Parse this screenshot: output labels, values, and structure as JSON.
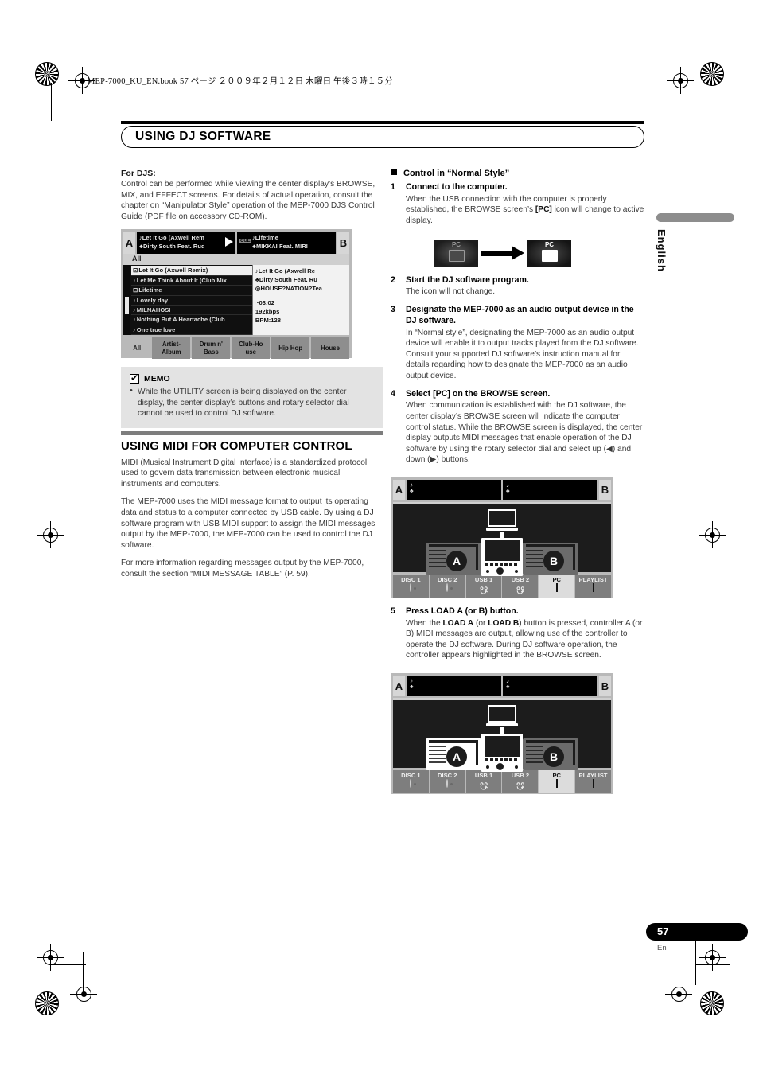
{
  "header": {
    "running_head": "MEP-7000_KU_EN.book   57 ページ   ２００９年２月１２日   木曜日   午後３時１５分",
    "section_title": "USING DJ SOFTWARE"
  },
  "side": {
    "language": "English"
  },
  "footer": {
    "page_number": "57",
    "page_suffix": "En"
  },
  "left": {
    "for_djs": {
      "heading": "For DJS:",
      "body": "Control can be performed while viewing the center display’s BROWSE, MIX, and EFFECT screens. For details of actual operation, consult the chapter on “Manipulator Style” operation of the MEP-7000 DJS Control Guide (PDF file on accessory CD-ROM)."
    },
    "browse_screen": {
      "deck_a_label": "A",
      "deck_b_label": "B",
      "deck_a_title": "Let It Go (Axwell Rem",
      "deck_a_artist": "Dirty South Feat. Rud",
      "deck_b_cue": "CUE",
      "deck_b_title": "Lifetime",
      "deck_b_artist": "MIKKAI Feat. MIRI",
      "folder_label": "All",
      "tracks": [
        {
          "title": "Let It Go (Axwell Remix)",
          "selected": true
        },
        {
          "title": "Let Me Think About It (Club Mix",
          "selected": false
        },
        {
          "title": "Lifetime",
          "selected": false
        },
        {
          "title": "Lovely day",
          "selected": false
        },
        {
          "title": "MILNAHOSI",
          "selected": false
        },
        {
          "title": "Nothing But A Heartache (Club",
          "selected": false
        },
        {
          "title": "One true love",
          "selected": false
        }
      ],
      "info": {
        "title": "Let It Go (Axwell Re",
        "artist": "Dirty South Feat. Ru",
        "album": "HOUSE?NATION?Tea",
        "time": "03:02",
        "bitrate": "192kbps",
        "bpm": "BPM:128"
      },
      "tabs": [
        "All",
        "Artist-Album",
        "Drum n' Bass",
        "Club-House",
        "Hip Hop",
        "House"
      ]
    },
    "memo": {
      "title": "MEMO",
      "item": "While the UTILITY screen is being displayed on the center display, the center display’s buttons and rotary selector dial cannot be used to control DJ software."
    },
    "midi": {
      "heading": "USING MIDI FOR COMPUTER CONTROL",
      "paragraphs": [
        "MIDI (Musical Instrument Digital Interface) is a standardized protocol used to govern data transmission between electronic musical instruments and computers.",
        "The MEP-7000 uses the MIDI message format to output its operating data and status to a computer connected by USB cable. By using a DJ software program with USB MIDI support to assign the MIDI messages output by the MEP-7000, the MEP-7000 can be used to control the DJ software.",
        "For more information regarding messages output by the MEP-7000, consult the section “MIDI MESSAGE TABLE” (P. 59)."
      ]
    }
  },
  "right": {
    "section_heading": "Control in “Normal Style”",
    "steps": [
      {
        "num": "1",
        "title": "Connect to the computer.",
        "desc": "When the USB connection with the computer is properly established, the BROWSE screen’s [PC] icon will change to active display."
      },
      {
        "num": "2",
        "title": "Start the DJ software program.",
        "desc": "The icon will not change."
      },
      {
        "num": "3",
        "title": "Designate the MEP-7000 as an audio output device in the DJ software.",
        "desc": "In “Normal style”, designating the MEP-7000 as an audio output device will enable it to output tracks played from the DJ software. Consult your supported DJ software’s instruction manual for details regarding how to designate the MEP-7000 as an audio output device."
      },
      {
        "num": "4",
        "title": "Select [PC] on the BROWSE screen.",
        "desc": "When communication is established with the DJ software, the center display’s BROWSE screen will indicate the computer control status. While the BROWSE screen is displayed, the center display outputs MIDI messages that enable operation of the DJ software by using the rotary selector dial and select up (◀) and down (▶) buttons."
      },
      {
        "num": "5",
        "title": "Press LOAD A (or B) button.",
        "desc": "When the LOAD A (or LOAD B) button is pressed, controller A (or B) MIDI messages are output, allowing use of the controller to operate the DJ software. During DJ software operation, the controller appears highlighted in the BROWSE screen."
      }
    ],
    "pc_icon_transition": {
      "inactive_label": "PC",
      "active_label": "PC"
    },
    "pc_screen_1": {
      "deck_a_label": "A",
      "deck_b_label": "B",
      "tabs": [
        "DISC 1",
        "DISC 2",
        "USB 1",
        "USB 2",
        "PC",
        "PLAYLIST"
      ],
      "active_tab": "PC",
      "deck_a_highlighted": false,
      "deck_b_highlighted": false,
      "controller_a_letter": "A",
      "controller_b_letter": "B"
    },
    "pc_screen_2": {
      "deck_a_label": "A",
      "deck_b_label": "B",
      "tabs": [
        "DISC 1",
        "DISC 2",
        "USB 1",
        "USB 2",
        "PC",
        "PLAYLIST"
      ],
      "active_tab": "PC",
      "deck_a_highlighted": true,
      "deck_b_highlighted": false,
      "controller_a_letter": "A",
      "controller_b_letter": "B"
    }
  },
  "colors": {
    "accent_black": "#000000",
    "memo_bg": "#e3e3e3",
    "rule_gray": "#7d7d7d",
    "body_text": "#3a3a3a"
  }
}
